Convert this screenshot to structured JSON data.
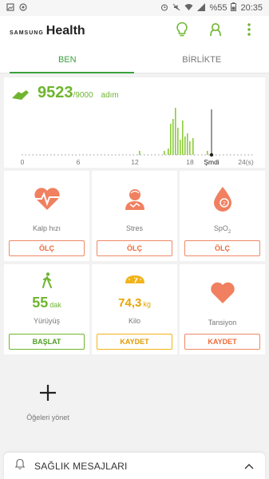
{
  "statusbar": {
    "battery_pct": "%55",
    "time": "20:35"
  },
  "appbar": {
    "brand_small": "SAMSUNG",
    "brand_big": "Health"
  },
  "tabs": [
    {
      "label": "BEN",
      "active": true
    },
    {
      "label": "BİRLİKTE",
      "active": false
    }
  ],
  "steps": {
    "value": "9523",
    "goal": "/9000",
    "unit": "adım",
    "axis_ticks": [
      "0",
      "6",
      "12",
      "18",
      "Şmdi",
      "24(s)"
    ]
  },
  "tiles": {
    "heart": {
      "label": "Kalp hızı",
      "button": "ÖLÇ"
    },
    "stress": {
      "label": "Stres",
      "button": "ÖLÇ"
    },
    "spo2": {
      "label_main": "SpO",
      "label_sub": "2",
      "button": "ÖLÇ"
    },
    "walking": {
      "value": "55",
      "unit": "dak",
      "label": "Yürüyüş",
      "button": "BAŞLAT"
    },
    "weight": {
      "value": "74,3",
      "unit": "kg",
      "label": "Kilo",
      "button": "KAYDET"
    },
    "blood_pressure": {
      "label": "Tansiyon",
      "button": "KAYDET"
    }
  },
  "manage": {
    "label": "Öğeleri yönet"
  },
  "messages": {
    "title": "SAĞLIK MESAJLARI"
  },
  "colors": {
    "green": "#6fb52f",
    "orange": "#ee6a3a",
    "yellow": "#f2b319"
  }
}
